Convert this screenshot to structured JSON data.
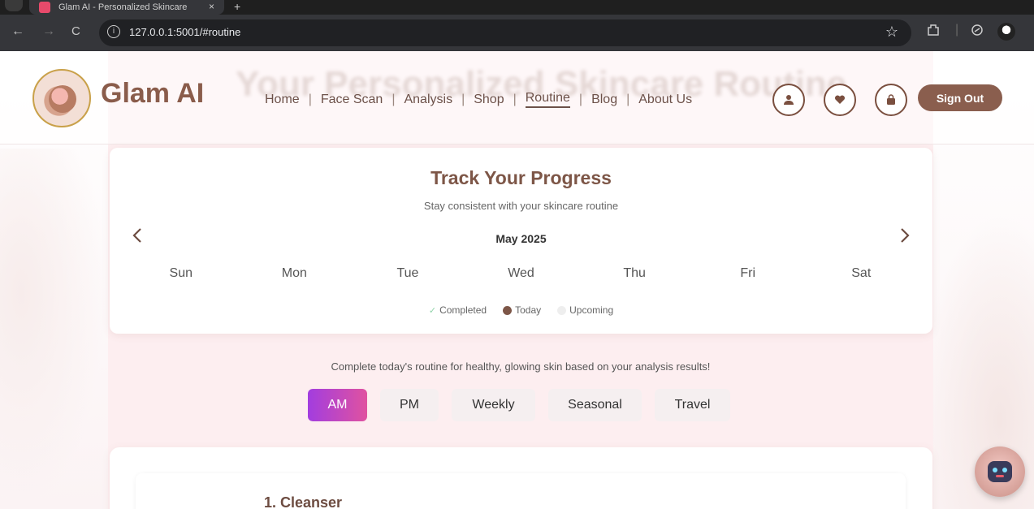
{
  "browser": {
    "tab_title": "Glam AI - Personalized Skincare",
    "tab_close": "×",
    "new_tab": "+",
    "url": "127.0.0.1:5001/#routine",
    "back": "←",
    "forward": "→",
    "reload": "C",
    "info": "i",
    "star": "☆"
  },
  "header": {
    "brand": "Glam AI",
    "background_title": "Your Personalized Skincare Routine",
    "nav": [
      "Home",
      "Face Scan",
      "Analysis",
      "Shop",
      "Routine",
      "Blog",
      "About Us"
    ],
    "nav_separator": "|",
    "active_nav": "Routine",
    "sign_out": "Sign Out"
  },
  "tracker": {
    "title": "Track Your Progress",
    "subtitle": "Stay consistent with your skincare routine",
    "month": "May 2025",
    "weekdays": [
      "Sun",
      "Mon",
      "Tue",
      "Wed",
      "Thu",
      "Fri",
      "Sat"
    ],
    "legend": {
      "completed": "Completed",
      "today": "Today",
      "upcoming": "Upcoming"
    }
  },
  "routine": {
    "intro": "Complete today's routine for healthy, glowing skin based on your analysis results!",
    "tabs": [
      "AM",
      "PM",
      "Weekly",
      "Seasonal",
      "Travel"
    ],
    "active_tab": "AM",
    "first_step": "1. Cleanser"
  },
  "colors": {
    "brand": "#8a5c4b",
    "active_tab_gradient_start": "#a23ddf",
    "active_tab_gradient_end": "#e052a0",
    "page_background": "#fdeef0"
  }
}
